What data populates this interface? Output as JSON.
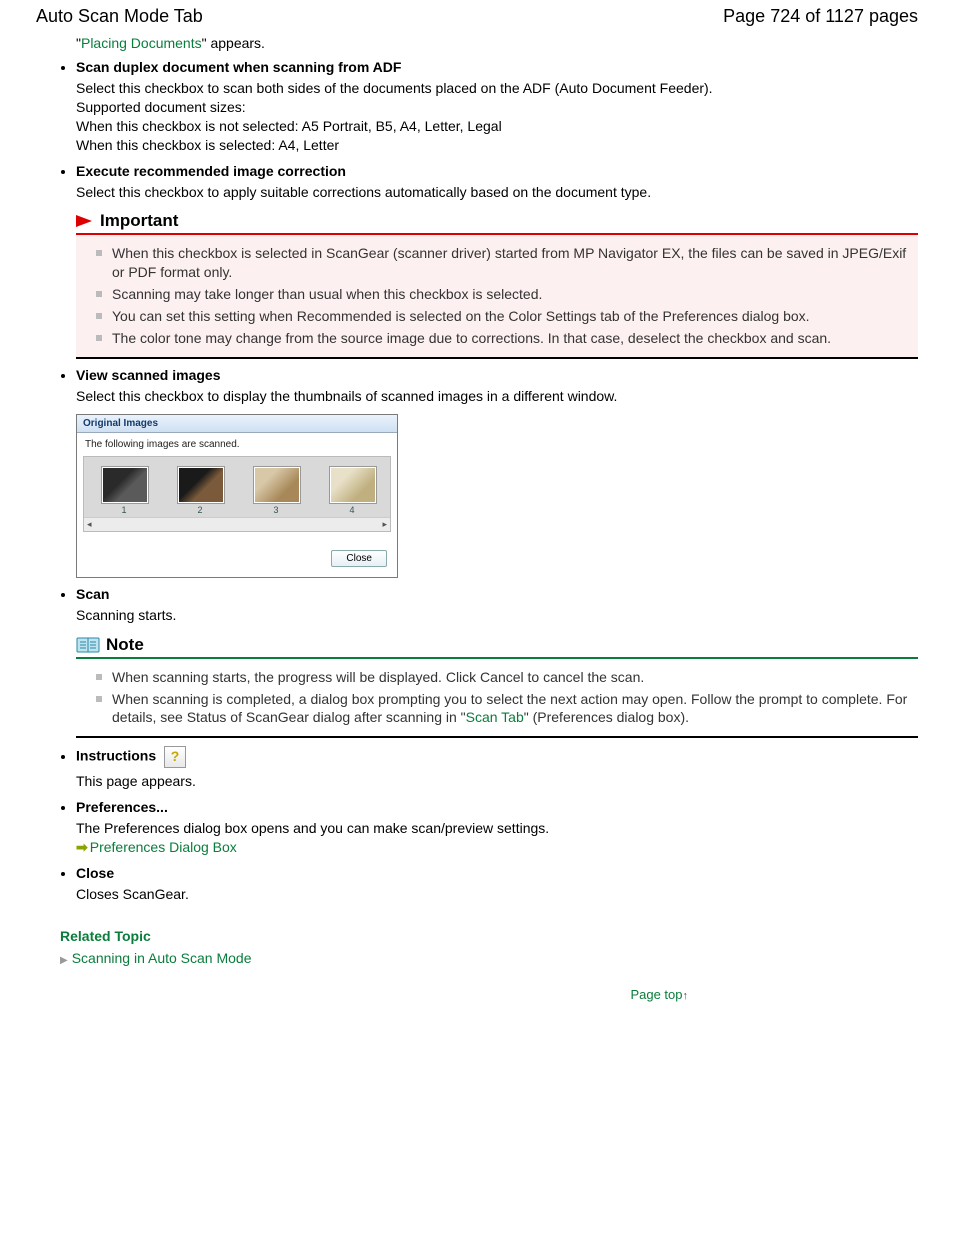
{
  "header": {
    "title": "Auto Scan Mode Tab",
    "page_label": "Page 724 of 1127 pages"
  },
  "intro": {
    "quote_open": "\"",
    "link": "Placing Documents",
    "quote_close": "\" appears."
  },
  "items": {
    "duplex": {
      "head": "Scan duplex document when scanning from ADF",
      "line1": "Select this checkbox to scan both sides of the documents placed on the ADF (Auto Document Feeder).",
      "line2": "Supported document sizes:",
      "line3": "When this checkbox is not selected: A5 Portrait, B5, A4, Letter, Legal",
      "line4": "When this checkbox is selected: A4, Letter"
    },
    "exec": {
      "head": "Execute recommended image correction",
      "body": "Select this checkbox to apply suitable corrections automatically based on the document type."
    },
    "view": {
      "head": "View scanned images",
      "body": "Select this checkbox to display the thumbnails of scanned images in a different window."
    },
    "scan": {
      "head": "Scan",
      "body": "Scanning starts."
    },
    "instr": {
      "head": "Instructions",
      "body": "This page appears."
    },
    "pref": {
      "head": "Preferences...",
      "body": "The Preferences dialog box opens and you can make scan/preview settings.",
      "link": "Preferences Dialog Box"
    },
    "close": {
      "head": "Close",
      "body": "Closes ScanGear."
    }
  },
  "important": {
    "title": "Important",
    "b1": "When this checkbox is selected in ScanGear (scanner driver) started from MP Navigator EX, the files can be saved in JPEG/Exif or PDF format only.",
    "b2": "Scanning may take longer than usual when this checkbox is selected.",
    "b3": "You can set this setting when Recommended is selected on the Color Settings tab of the Preferences dialog box.",
    "b4": "The color tone may change from the source image due to corrections. In that case, deselect the checkbox and scan."
  },
  "note": {
    "title": "Note",
    "b1": "When scanning starts, the progress will be displayed. Click Cancel to cancel the scan.",
    "b2_a": "When scanning is completed, a dialog box prompting you to select the next action may open. Follow the prompt to complete. For details, see Status of ScanGear dialog after scanning in \"",
    "b2_link": "Scan Tab",
    "b2_b": "\" (Preferences dialog box)."
  },
  "shot": {
    "title": "Original Images",
    "sub": "The following images are scanned.",
    "n1": "1",
    "n2": "2",
    "n3": "3",
    "n4": "4",
    "close": "Close"
  },
  "related": {
    "head": "Related Topic",
    "link": "Scanning in Auto Scan Mode"
  },
  "page_top": "Page top"
}
